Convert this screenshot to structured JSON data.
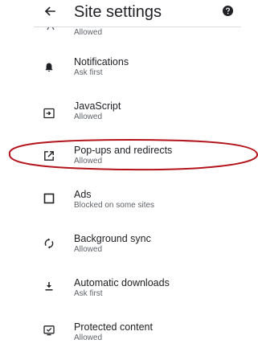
{
  "header": {
    "title": "Site settings",
    "back_icon": "arrow-back-icon",
    "help_icon": "help-icon"
  },
  "partial_item": {
    "status": "Allowed"
  },
  "items": [
    {
      "label": "Notifications",
      "status": "Ask first",
      "icon": "bell-icon"
    },
    {
      "label": "JavaScript",
      "status": "Allowed",
      "icon": "javascript-icon"
    },
    {
      "label": "Pop-ups and redirects",
      "status": "Allowed",
      "icon": "open-external-icon"
    },
    {
      "label": "Ads",
      "status": "Blocked on some sites",
      "icon": "ads-icon"
    },
    {
      "label": "Background sync",
      "status": "Allowed",
      "icon": "sync-icon"
    },
    {
      "label": "Automatic downloads",
      "status": "Ask first",
      "icon": "download-icon"
    },
    {
      "label": "Protected content",
      "status": "Allowed",
      "icon": "protected-content-icon"
    }
  ],
  "annotation": {
    "color": "#b3141b",
    "target": "Pop-ups and redirects"
  }
}
